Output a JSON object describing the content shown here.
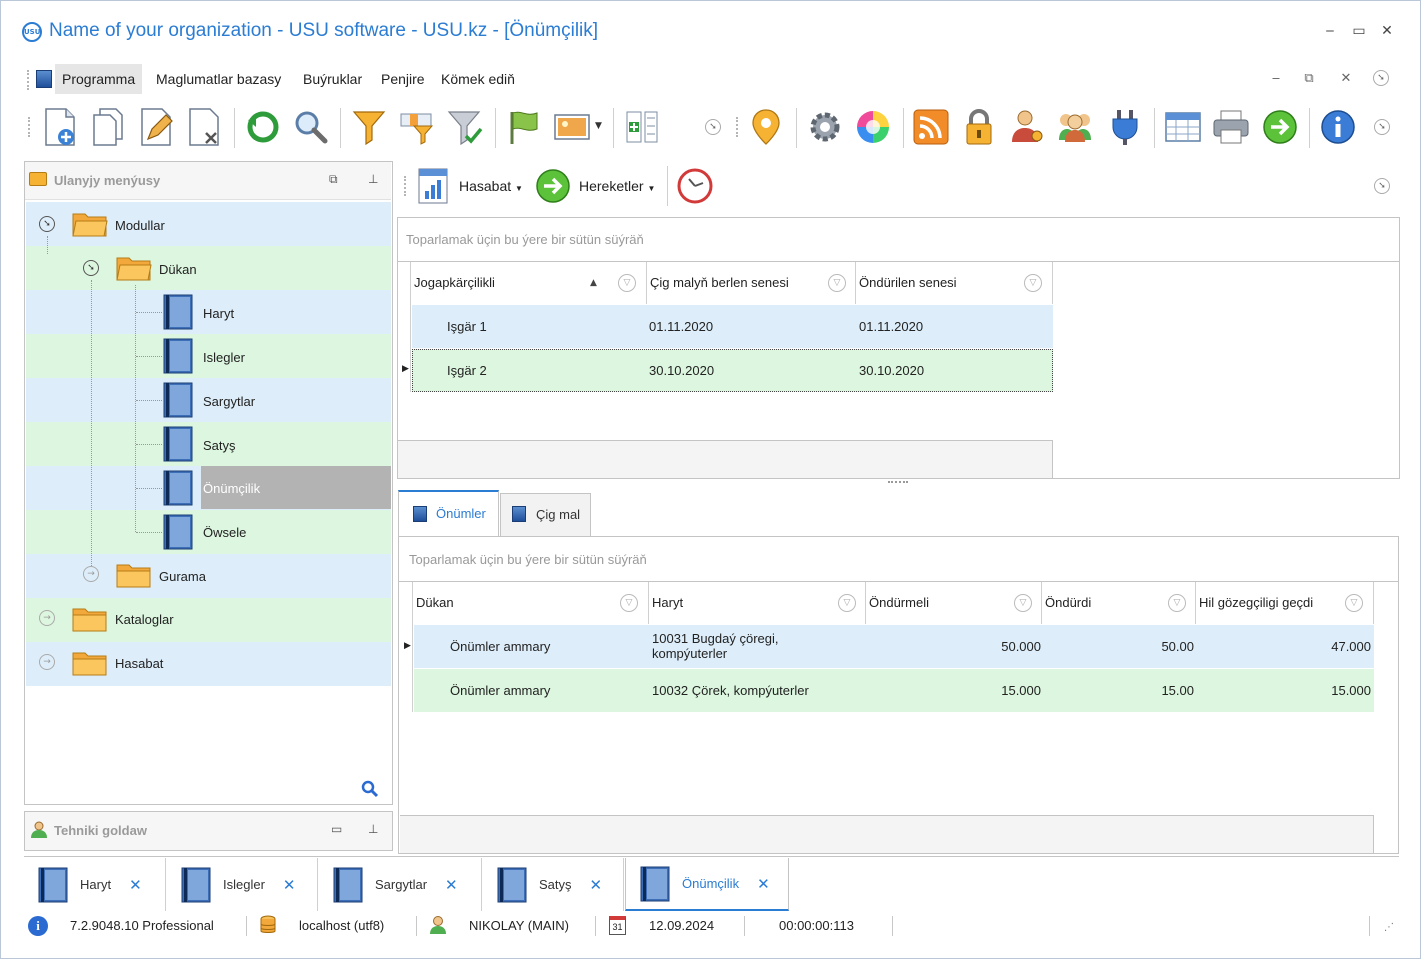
{
  "window": {
    "title": "Name of your organization - USU software - USU.kz - [Önümçilik]",
    "logo_text": "USU"
  },
  "menu": [
    {
      "label": "Programma",
      "active": true
    },
    {
      "label": "Maglumatlar bazasy"
    },
    {
      "label": "Buýruklar"
    },
    {
      "label": "Penjire"
    },
    {
      "label": "Kömek ediň"
    }
  ],
  "nav_panel": {
    "title": "Ulanyjy menýusy",
    "items": [
      {
        "label": "Modullar"
      },
      {
        "label": "Dükan"
      },
      {
        "label": "Haryt"
      },
      {
        "label": "Islegler"
      },
      {
        "label": "Sargytlar"
      },
      {
        "label": "Satyş"
      },
      {
        "label": "Önümçilik"
      },
      {
        "label": "Öwsele"
      },
      {
        "label": "Gurama"
      },
      {
        "label": "Kataloglar"
      },
      {
        "label": "Hasabat"
      }
    ]
  },
  "tech_panel": {
    "title": "Tehniki goldaw"
  },
  "sub_toolbar": {
    "report_label": "Hasabat",
    "actions_label": "Hereketler"
  },
  "grid_top": {
    "group_hint": "Toparlamak üçin bu ýere bir sütün süýräň",
    "columns": [
      "Jogapkärçilikli",
      "Çig malyň berlen senesi",
      "Öndürilen senesi"
    ],
    "rows": [
      [
        "Işgär 1",
        "01.11.2020",
        "01.11.2020"
      ],
      [
        "Işgär 2",
        "30.10.2020",
        "30.10.2020"
      ]
    ]
  },
  "detail_tabs": [
    {
      "label": "Önümler",
      "active": true
    },
    {
      "label": "Çig mal"
    }
  ],
  "grid_bottom": {
    "group_hint": "Toparlamak üçin bu ýere bir sütün süýräň",
    "columns": [
      "Dükan",
      "Haryt",
      "Öndürmeli",
      "Öndürdi",
      "Hil gözegçiligi geçdi"
    ],
    "rows": [
      [
        "Önümler ammary",
        "10031 Bugdaý çöregi, kompýuterler",
        "50.000",
        "50.00",
        "47.000"
      ],
      [
        "Önümler ammary",
        "10032 Çörek, kompýuterler",
        "15.000",
        "15.00",
        "15.000"
      ]
    ]
  },
  "doc_tabs": [
    {
      "label": "Haryt"
    },
    {
      "label": "Islegler"
    },
    {
      "label": "Sargytlar"
    },
    {
      "label": "Satyş"
    },
    {
      "label": "Önümçilik",
      "active": true
    }
  ],
  "status": {
    "version": "7.2.9048.10 Professional",
    "db": "localhost (utf8)",
    "user": "NIKOLAY (MAIN)",
    "calendar_day": "31",
    "date": "12.09.2024",
    "timer": "00:00:00:113"
  },
  "colors": {
    "accent": "#2b7cd3",
    "row_blue": "#ddeefa",
    "row_green": "#dcf6df",
    "selected": "#b3b3b3"
  }
}
